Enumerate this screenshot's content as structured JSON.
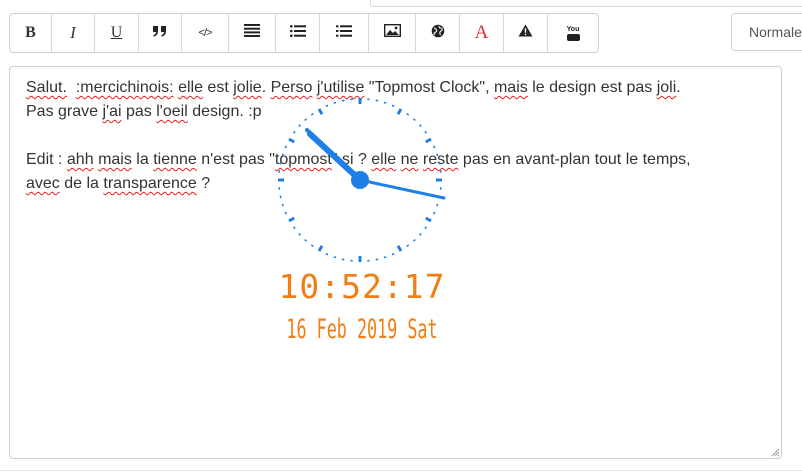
{
  "toolbar": {
    "buttons": [
      {
        "name": "bold-button",
        "icon": "bold-icon",
        "glyph": "B"
      },
      {
        "name": "italic-button",
        "icon": "italic-icon",
        "glyph": "I"
      },
      {
        "name": "underline-button",
        "icon": "underline-icon",
        "glyph": "U"
      },
      {
        "name": "quote-button",
        "icon": "quote-icon",
        "glyph": "❞"
      },
      {
        "name": "code-button",
        "icon": "code-icon",
        "glyph": "</>"
      },
      {
        "name": "list-button",
        "icon": "list-icon"
      },
      {
        "name": "bullet-list-button",
        "icon": "bullet-list-icon"
      },
      {
        "name": "numbered-list-button",
        "icon": "numbered-list-icon"
      },
      {
        "name": "image-button",
        "icon": "image-icon"
      },
      {
        "name": "link-button",
        "icon": "globe-icon"
      },
      {
        "name": "text-color-button",
        "icon": "font-color-icon",
        "glyph": "A",
        "color": "#e03030"
      },
      {
        "name": "warning-button",
        "icon": "warning-icon"
      },
      {
        "name": "youtube-button",
        "icon": "youtube-icon",
        "glyph": "You"
      }
    ]
  },
  "format_select": {
    "value": "Normale"
  },
  "editor": {
    "paragraph1": {
      "s1": "Salut.",
      "s2": "  ",
      "s3": ":mercichinois:",
      "s4": " ",
      "s5": "elle",
      "s6": " est ",
      "s7": "jolie",
      "s8": ". ",
      "s9": "Perso",
      "s10": " ",
      "s11": "j'utilise",
      "s12": " \"Topmost Clock\", ",
      "s13": "mais",
      "s14": " le design est pas ",
      "s15": "joli",
      "s16": ".",
      "s17": "Pas grave ",
      "s18": "j'ai",
      "s19": " pas ",
      "s20": "l'oeil",
      "s21": " design. :p"
    },
    "paragraph2": {
      "t1": "Edit : ",
      "t2": "ahh",
      "t3": " ",
      "t4": "mais",
      "t5": " la ",
      "t6": "tienne",
      "t7": " n'est pas \"",
      "t8": "topmost",
      "t9": "\" si ? ",
      "t10": "elle",
      "t11": " ",
      "t12": "ne",
      "t13": " ",
      "t14": "reste",
      "t15": " pas en avant-plan tout le temps,",
      "t16": "avec",
      "t17": " de la ",
      "t18": "transparence",
      "t19": " ?"
    }
  },
  "clock": {
    "time": "10:52:17",
    "date": "16 Feb 2019 Sat",
    "color_face": "#1e7fe6",
    "color_text": "#f07e14"
  }
}
